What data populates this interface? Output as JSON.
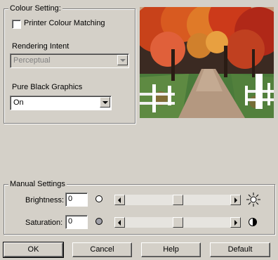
{
  "colour_setting": {
    "title": "Colour Setting:",
    "printer_colour_matching_label": "Printer Colour Matching",
    "printer_colour_matching_checked": false,
    "rendering_intent_label": "Rendering Intent",
    "rendering_intent_value": "Perceptual",
    "rendering_intent_enabled": false,
    "pure_black_label": "Pure Black Graphics",
    "pure_black_value": "On"
  },
  "manual_settings": {
    "title": "Manual Settings",
    "brightness_label": "Brightness:",
    "brightness_value": "0",
    "saturation_label": "Saturation:",
    "saturation_value": "0",
    "brightness_slider_level": 0.5,
    "saturation_slider_level": 0.5
  },
  "buttons": {
    "ok": "OK",
    "cancel": "Cancel",
    "help": "Help",
    "default": "Default"
  },
  "colors": {
    "dialog_bg": "#d4d0c8",
    "field_bg": "#ffffff",
    "disabled_text": "#808080"
  },
  "icons": {
    "brightness_low": "circle-outline-icon",
    "brightness_high": "sun-icon",
    "saturation_low": "grey-circle-icon",
    "saturation_high": "half-circle-icon",
    "preview": "autumn-road-photo"
  }
}
